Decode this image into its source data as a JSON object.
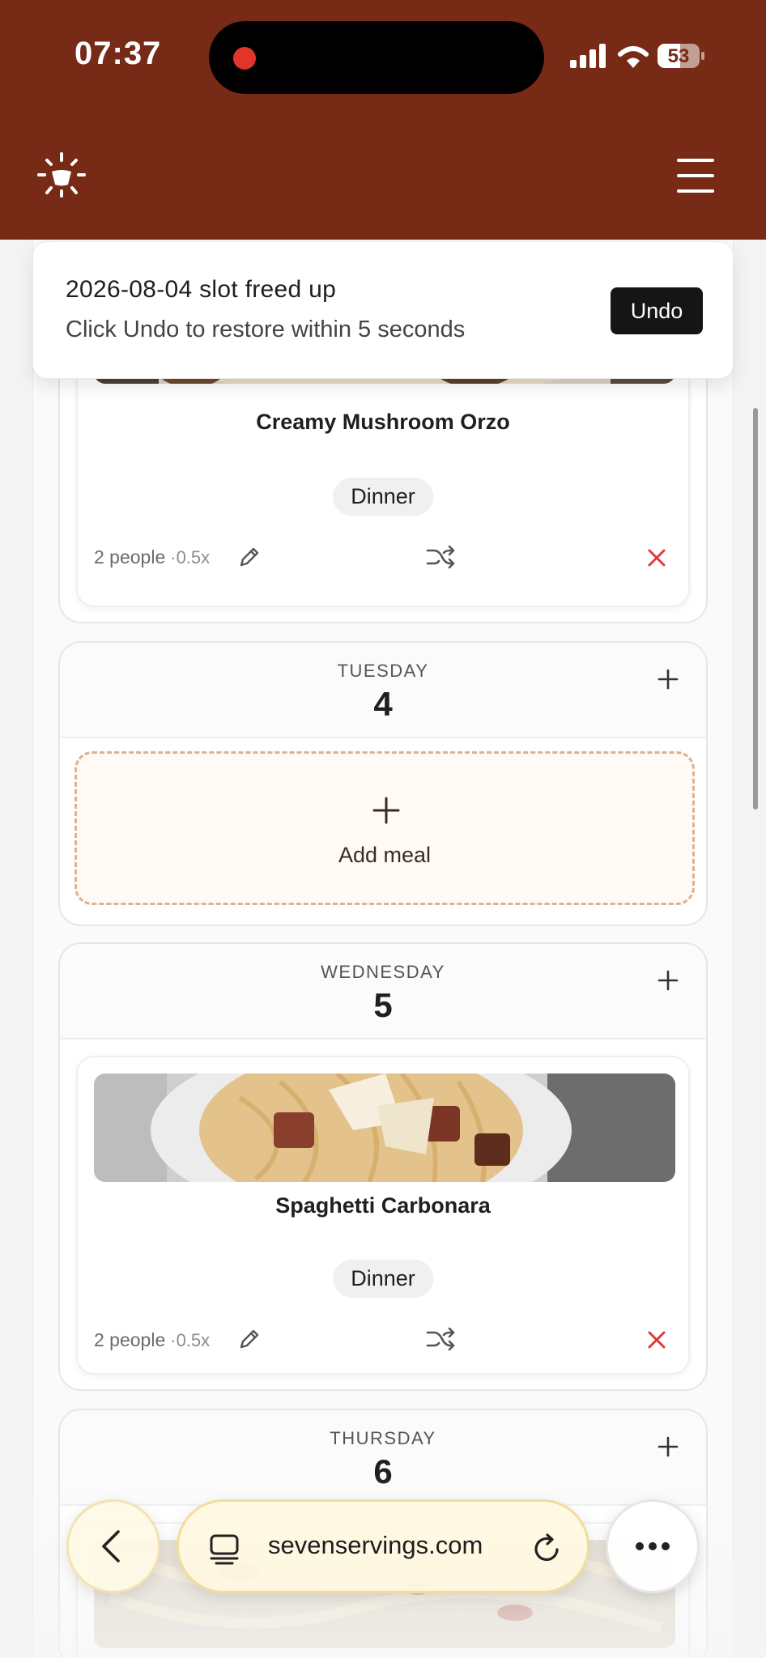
{
  "status_bar": {
    "time": "07:37",
    "battery": "53",
    "battery_level": 0.53
  },
  "header": {
    "logo_icon": "lightbulb-icon",
    "menu_icon": "hamburger-menu-icon",
    "background": "#772a16"
  },
  "toast": {
    "title": "2026-08-04 slot freed up",
    "message": "Click Undo to restore within 5 seconds",
    "undo_label": "Undo"
  },
  "days": [
    {
      "meal": {
        "title": "Creamy Mushroom Orzo",
        "tag": "Dinner",
        "people": "2 people",
        "multiplier": "·0.5x"
      }
    },
    {
      "day_name": "TUESDAY",
      "day_number": "4",
      "add_label": "Add meal"
    },
    {
      "day_name": "WEDNESDAY",
      "day_number": "5",
      "meal": {
        "title": "Spaghetti Carbonara",
        "tag": "Dinner",
        "people": "2 people",
        "multiplier": "·0.5x"
      }
    },
    {
      "day_name": "THURSDAY",
      "day_number": "6"
    }
  ],
  "browser": {
    "url": "sevenservings.com"
  },
  "colors": {
    "accent": "#772a16",
    "remove": "#e03a3a",
    "dashed_border": "#dcb28f"
  }
}
